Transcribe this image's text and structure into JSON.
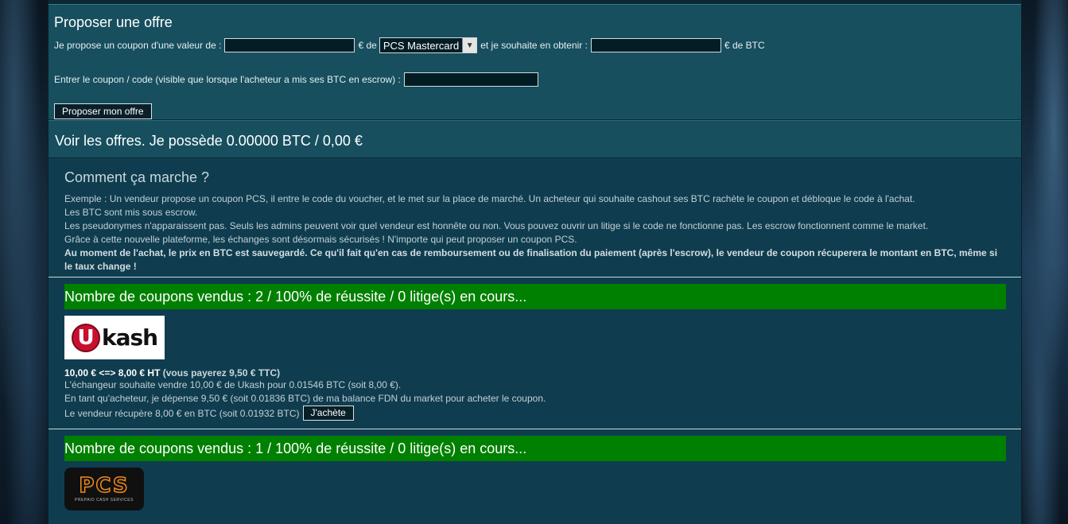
{
  "offer_form": {
    "title": "Proposer une offre",
    "label_value": "Je propose un coupon d'une valeur de :",
    "value_input": "",
    "label_currency_de": "€ de",
    "coupon_type_selected": "PCS Mastercard",
    "label_want": "et je souhaite en obtenir :",
    "want_input": "",
    "label_btc": "€ de BTC",
    "label_code": "Entrer le coupon / code (visible que lorsque l'acheteur a mis ses BTC en escrow) :",
    "code_input": "",
    "submit_label": "Proposer mon offre"
  },
  "balance": {
    "text": "Voir les offres. Je possède 0.00000 BTC / 0,00 €"
  },
  "how_it_works": {
    "title": "Comment ça marche ?",
    "p1": "Exemple : Un vendeur propose un coupon PCS, il entre le code du voucher, et le met sur la place de marché. Un acheteur qui souhaite cashout ses BTC rachète le coupon et débloque le code à l'achat.",
    "p2": "Les BTC sont mis sous escrow.",
    "p3": "Les pseudonymes n'apparaissent pas. Seuls les admins peuvent voir quel vendeur est honnête ou non. Vous pouvez ouvrir un litige si le code ne fonctionne pas. Les escrow fonctionnent comme le market.",
    "p4": "Grâce à cette nouvelle plateforme, les échanges sont désormais sécurisés ! N'importe qui peut proposer un coupon PCS.",
    "p5": "Au moment de l'achat, le prix en BTC est sauvegardé. Ce qu'il fait qu'en cas de remboursement ou de finalisation du paiement (après l'escrow), le vendeur de coupon récuperera le montant en BTC, même si le taux change !"
  },
  "offers": [
    {
      "banner": "Nombre de coupons vendus : 2 / 100% de réussite / 0 litige(s) en cours...",
      "logo": "ukash-logo",
      "logo_u": "U",
      "logo_text": "kash",
      "price_main": "10,00 € <=> 8,00 € HT",
      "price_ttc": "(vous payerez 9,50 € TTC)",
      "line1": "L'échangeur souhaite vendre 10,00 € de Ukash pour 0.01546 BTC (soit 8,00 €).",
      "line2": "En tant qu'acheteur, je dépense 9,50 € (soit 0.01836 BTC) de ma balance FDN du market pour acheter le coupon.",
      "line3": "Le vendeur récupère 8,00 € en BTC (soit 0.01932 BTC)",
      "buy_label": "J'achète"
    },
    {
      "banner": "Nombre de coupons vendus : 1 / 100% de réussite / 0 litige(s) en cours...",
      "logo": "pcs-logo",
      "logo_text": "PCS",
      "logo_sub": "PREPAID CASH SERVICES"
    }
  ],
  "colors": {
    "panel": "#174f5f",
    "background": "#0f3d4f",
    "banner_green": "#008000"
  }
}
